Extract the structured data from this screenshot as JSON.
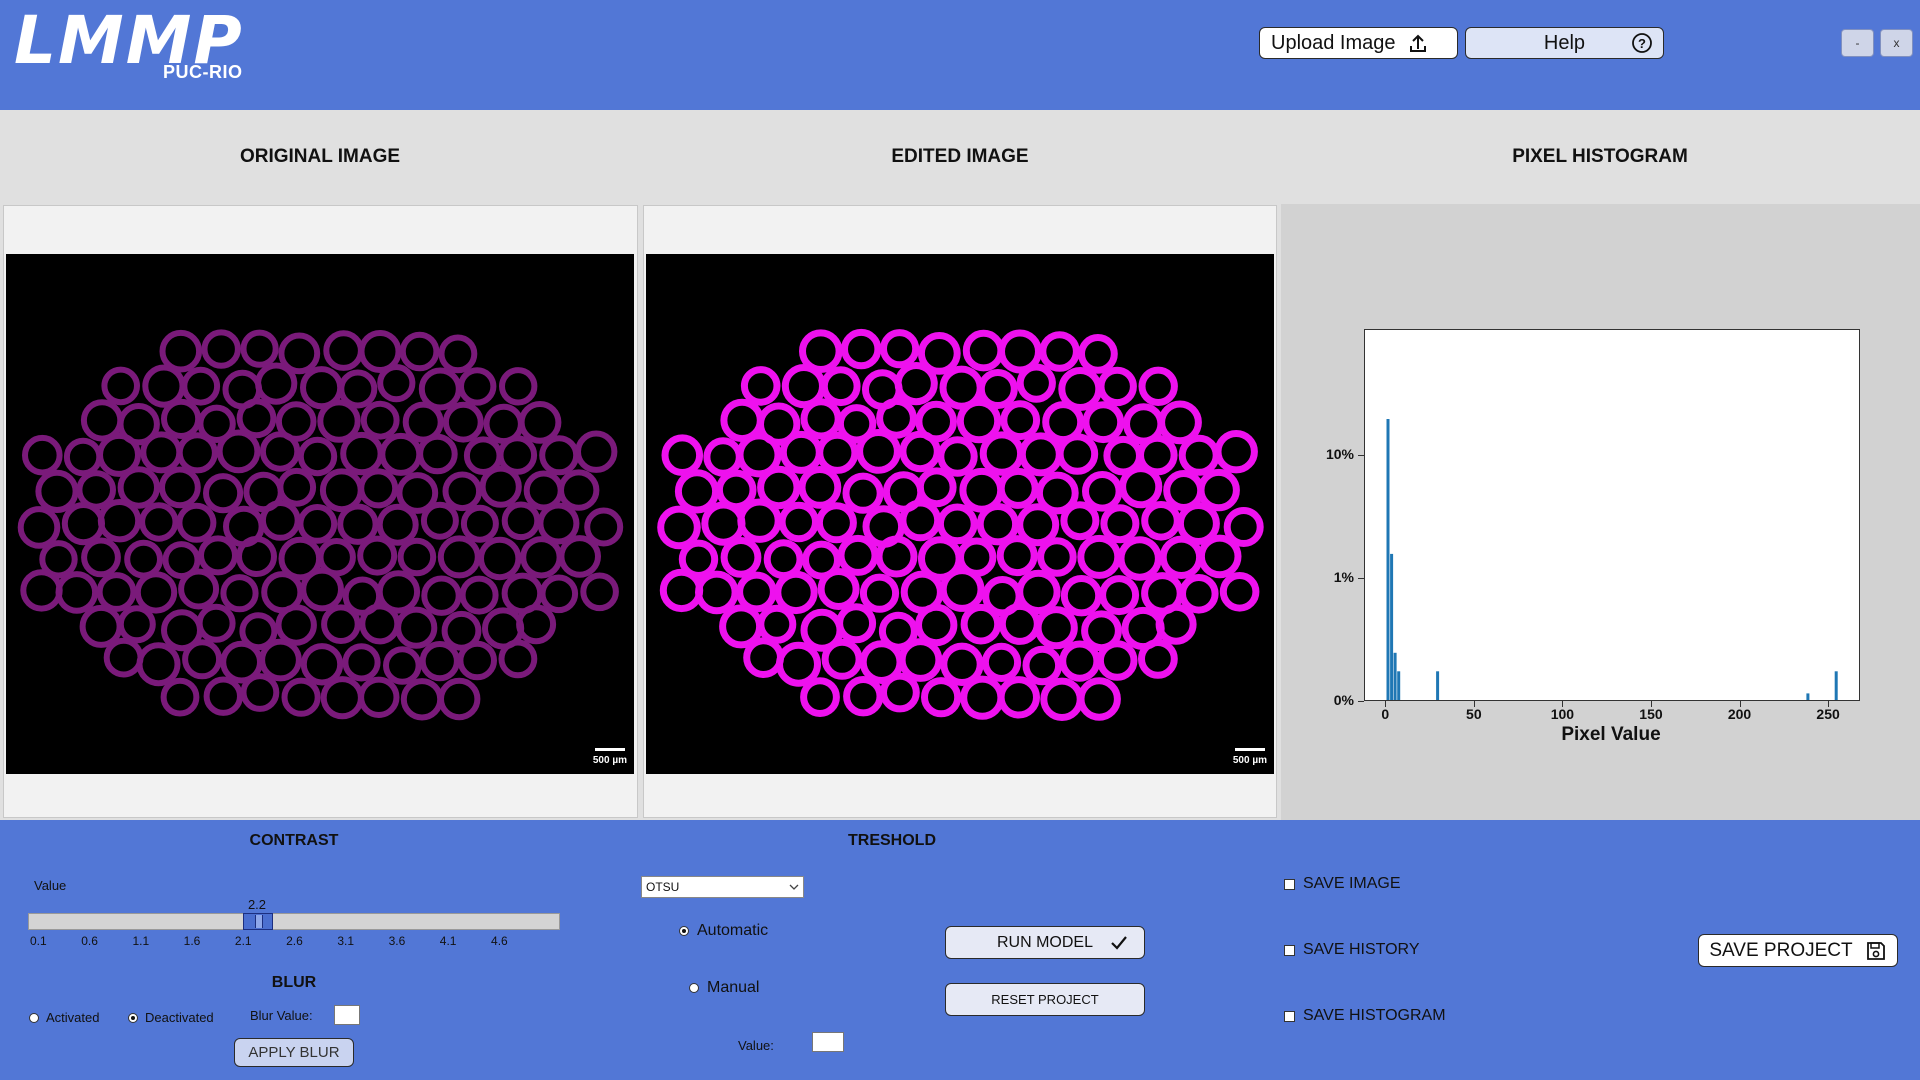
{
  "header": {
    "logo_main": "LMMP",
    "logo_sub": "PUC-RIO",
    "upload_label": "Upload Image",
    "help_label": "Help",
    "minimize_label": "-",
    "close_label": "x",
    "colors": {
      "bar": "#5277d6",
      "text": "#ffffff"
    }
  },
  "panels": {
    "original_title": "ORIGINAL IMAGE",
    "edited_title": "EDITED IMAGE",
    "histogram_title": "PIXEL HISTOGRAM",
    "scale_label": "500 µm",
    "original_fill": "#7a1a7a",
    "edited_fill": "#ee11ee"
  },
  "histogram": {
    "xlabel": "Pixel Value",
    "x_ticks": [
      "0",
      "50",
      "100",
      "150",
      "200",
      "250"
    ],
    "y_ticks": [
      "10%",
      "1%",
      "0%"
    ]
  },
  "chart_data": {
    "type": "bar",
    "xlabel": "Pixel Value",
    "ylabel": "",
    "xlim": [
      -12,
      268
    ],
    "yscale": "symlog",
    "y_tick_values": [
      0,
      1,
      10
    ],
    "y_tick_labels": [
      "0%",
      "1%",
      "10%"
    ],
    "bars": [
      {
        "x": 1,
        "y": 20.0
      },
      {
        "x": 3,
        "y": 1.6
      },
      {
        "x": 5,
        "y": 0.4
      },
      {
        "x": 7,
        "y": 0.25
      },
      {
        "x": 29,
        "y": 0.25
      },
      {
        "x": 238,
        "y": 0.07
      },
      {
        "x": 254,
        "y": 0.25
      }
    ],
    "color": "#1f77b4",
    "grid": false
  },
  "contrast": {
    "title": "CONTRAST",
    "value_label": "Value",
    "current_value": "2.2",
    "min": 0.1,
    "max": 5.0,
    "value": 2.2,
    "ticks": [
      "0.1",
      "0.6",
      "1.1",
      "1.6",
      "2.1",
      "2.6",
      "3.1",
      "3.6",
      "4.1",
      "4.6"
    ]
  },
  "blur": {
    "title": "BLUR",
    "activated_label": "Activated",
    "deactivated_label": "Deactivated",
    "selected": "Deactivated",
    "blur_value_label": "Blur Value:",
    "apply_label": "APPLY BLUR"
  },
  "threshold": {
    "title": "TRESHOLD",
    "method": "OTSU",
    "automatic_label": "Automatic",
    "manual_label": "Manual",
    "selected": "Automatic",
    "value_label": "Value:"
  },
  "actions": {
    "run_model_label": "RUN MODEL",
    "reset_label": "RESET PROJECT",
    "save_image_label": "SAVE IMAGE",
    "save_history_label": "SAVE HISTORY",
    "save_histogram_label": "SAVE HISTOGRAM",
    "save_project_label": "SAVE PROJECT"
  }
}
